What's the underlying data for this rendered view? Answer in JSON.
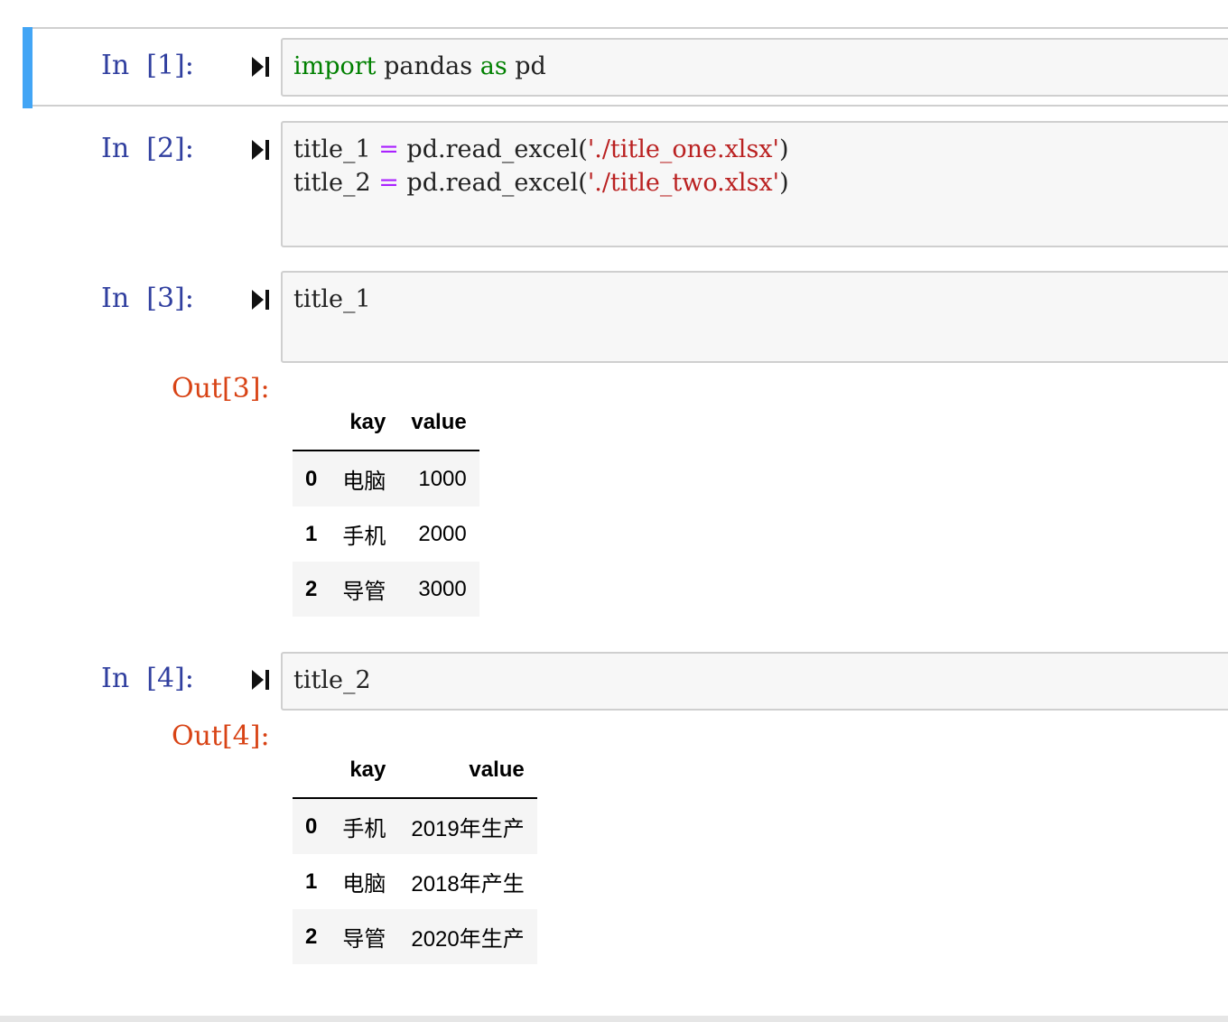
{
  "cells": [
    {
      "in_prompt": "In  [1]:",
      "code": [
        [
          {
            "t": "import",
            "c": "kw"
          },
          {
            "t": " pandas "
          },
          {
            "t": "as",
            "c": "kw"
          },
          {
            "t": " pd"
          }
        ]
      ]
    },
    {
      "in_prompt": "In  [2]:",
      "code": [
        [
          {
            "t": "title_1 "
          },
          {
            "t": "=",
            "c": "op"
          },
          {
            "t": " pd.read_excel("
          },
          {
            "t": "'./title_one.xlsx'",
            "c": "str"
          },
          {
            "t": ")"
          }
        ],
        [
          {
            "t": "title_2 "
          },
          {
            "t": "=",
            "c": "op"
          },
          {
            "t": " pd.read_excel("
          },
          {
            "t": "'./title_two.xlsx'",
            "c": "str"
          },
          {
            "t": ")"
          }
        ]
      ]
    },
    {
      "in_prompt": "In  [3]:",
      "code": [
        [
          {
            "t": "title_1"
          }
        ]
      ],
      "out_prompt": "Out[3]:",
      "table": {
        "columns": [
          "",
          "kay",
          "value"
        ],
        "rows": [
          {
            "index": "0",
            "kay": "电脑",
            "value": "1000"
          },
          {
            "index": "1",
            "kay": "手机",
            "value": "2000"
          },
          {
            "index": "2",
            "kay": "导管",
            "value": "3000"
          }
        ]
      }
    },
    {
      "in_prompt": "In  [4]:",
      "code": [
        [
          {
            "t": "title_2"
          }
        ]
      ],
      "out_prompt": "Out[4]:",
      "table": {
        "columns": [
          "",
          "kay",
          "value"
        ],
        "rows": [
          {
            "index": "0",
            "kay": "手机",
            "value": "2019年生产"
          },
          {
            "index": "1",
            "kay": "电脑",
            "value": "2018年产生"
          },
          {
            "index": "2",
            "kay": "导管",
            "value": "2020年生产"
          }
        ]
      }
    }
  ],
  "icons": {
    "run": "run-cell-icon"
  },
  "colors": {
    "selection_bar": "#42a5f5",
    "in_prompt": "#303f9f",
    "out_prompt": "#d84315",
    "keyword": "#008000",
    "operator": "#aa22ff",
    "string": "#ba2121"
  }
}
